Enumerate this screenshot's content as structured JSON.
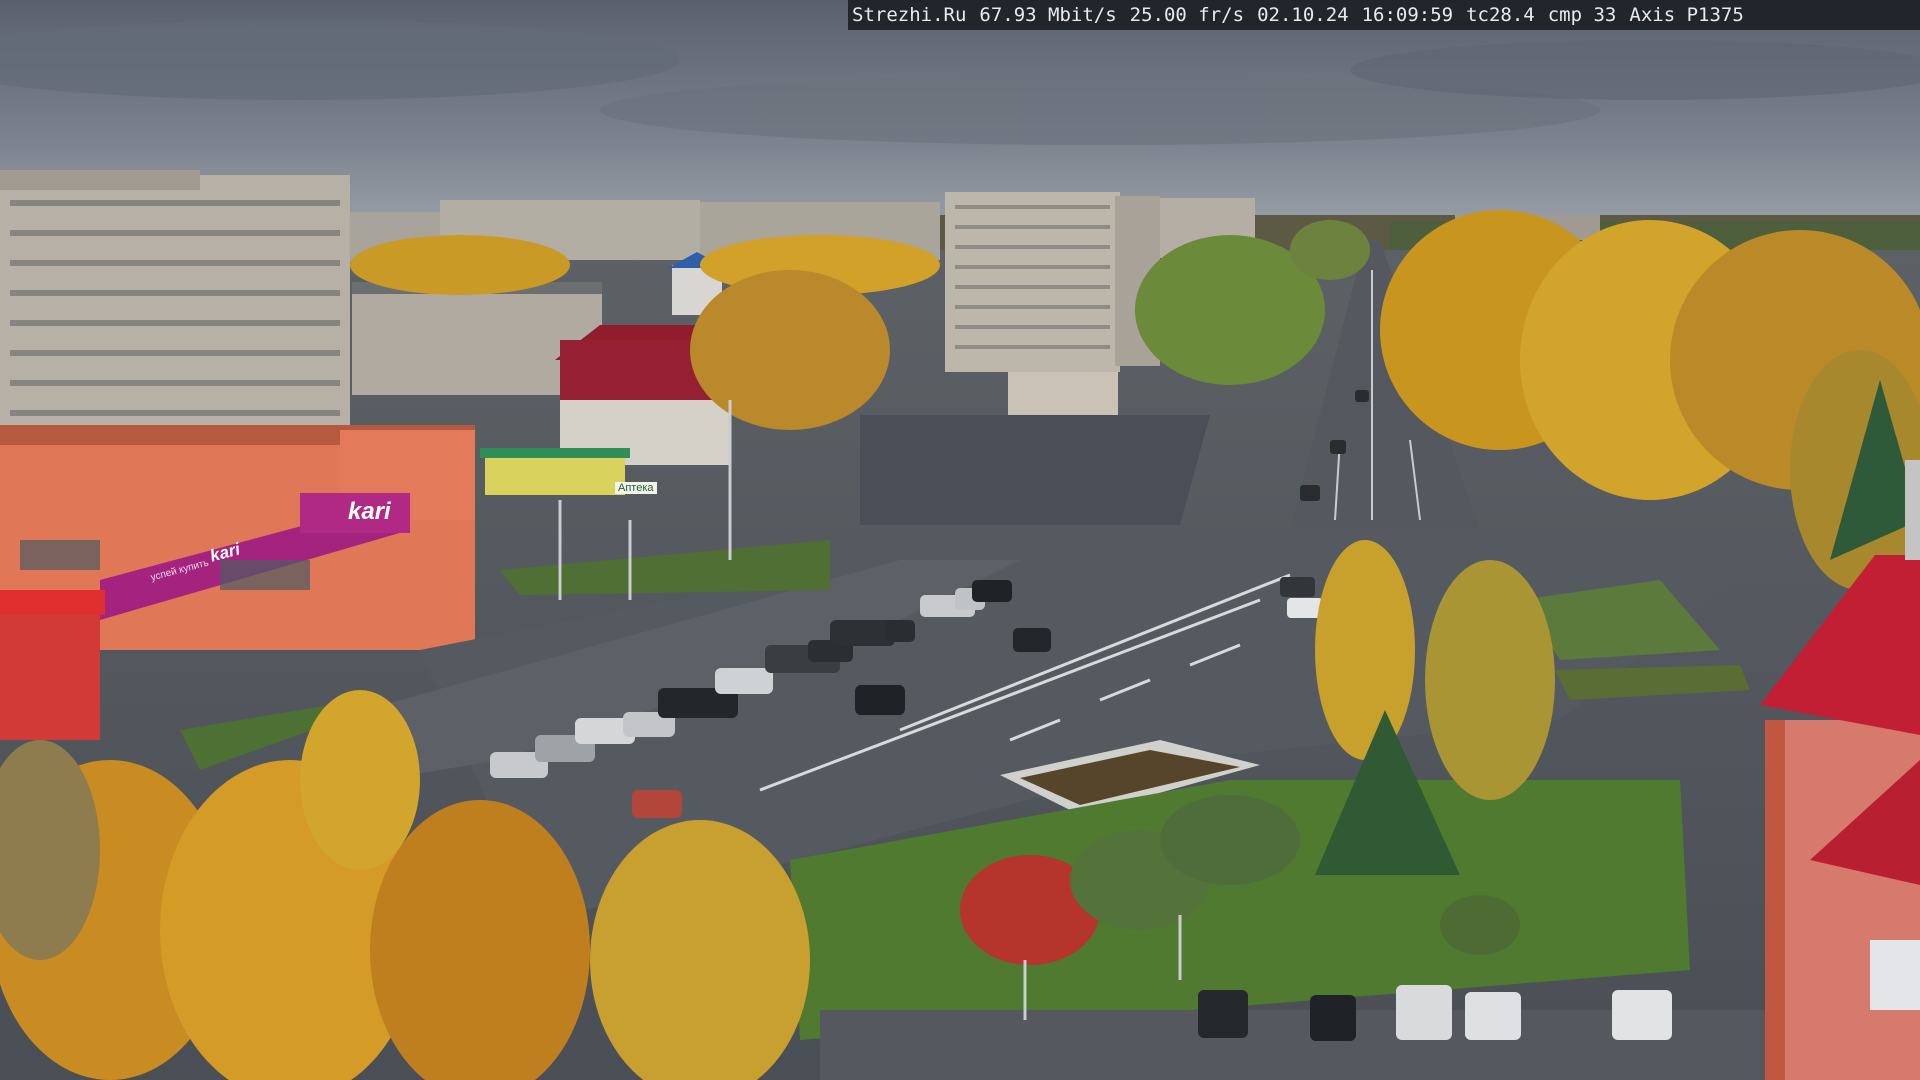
{
  "overlay": {
    "site": "Strezhi.Ru",
    "bitrate": "67.93 Mbit/s",
    "framerate": "25.00 fr/s",
    "date": "02.10.24",
    "time": "16:09:59",
    "tc": "tc28.4",
    "cmp": "cmp 33",
    "camera": "Axis P1375"
  },
  "signs": {
    "store_main": "kari",
    "store_banner": "kari",
    "store_banner_small": "успей купить",
    "pharmacy": "Аптека"
  },
  "colors": {
    "sky": "#6f7683",
    "asphalt": "#4e535c",
    "grass": "#5a7a3a",
    "birch_yellow": "#d9a52a",
    "kari_magenta": "#a3237e",
    "roof_red": "#b0232e"
  }
}
